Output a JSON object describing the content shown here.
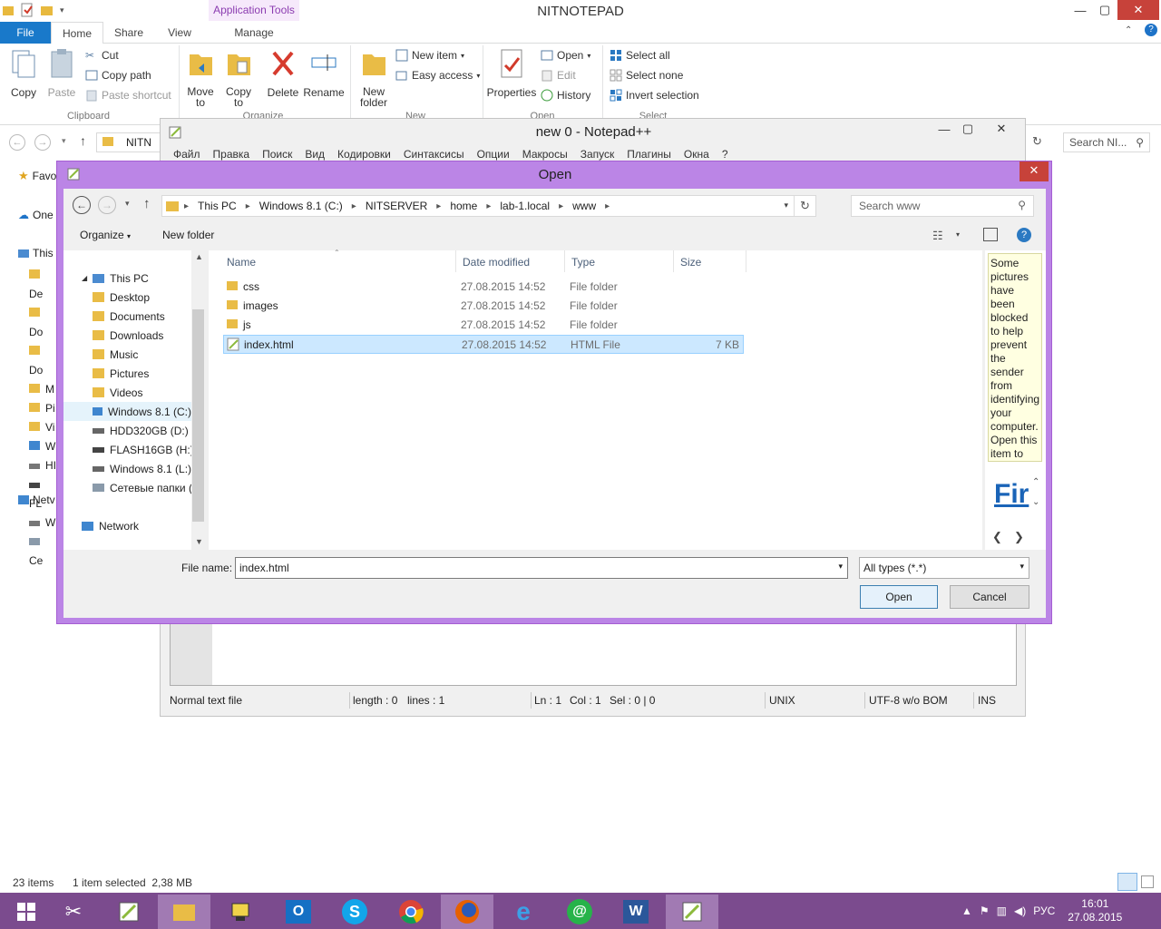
{
  "explorer": {
    "title": "NITNOTEPAD",
    "context_tab": "Application Tools",
    "tabs": [
      "File",
      "Home",
      "Share",
      "View",
      "Manage"
    ],
    "ribbon": {
      "copy": "Copy",
      "paste": "Paste",
      "cut": "Cut",
      "copy_path": "Copy path",
      "paste_shortcut": "Paste shortcut",
      "clipboard": "Clipboard",
      "move_to": "Move to",
      "copy_to": "Copy to",
      "delete": "Delete",
      "rename": "Rename",
      "organize": "Organize",
      "new_folder": "New folder",
      "new_item": "New item",
      "easy_access": "Easy access",
      "new": "New",
      "properties": "Properties",
      "open": "Open",
      "edit": "Edit",
      "history": "History",
      "open_group": "Open",
      "select_all": "Select all",
      "select_none": "Select none",
      "invert_selection": "Invert selection",
      "select": "Select"
    },
    "address_partial": "NITN",
    "search_placeholder": "Search NI...",
    "nav_partial": [
      "Favo",
      "One",
      "This",
      "De",
      "Do",
      "Do",
      "M",
      "Pi",
      "Vi",
      "W",
      "HI",
      "FL",
      "W",
      "Ce",
      "Netv"
    ],
    "status": {
      "items": "23 items",
      "selected": "1 item selected  2,38 MB"
    }
  },
  "notepad": {
    "title": "new  0 - Notepad++",
    "menu": [
      "Файл",
      "Правка",
      "Поиск",
      "Вид",
      "Кодировки",
      "Синтаксисы",
      "Опции",
      "Макросы",
      "Запуск",
      "Плагины",
      "Окна",
      "?"
    ],
    "status": {
      "type": "Normal text file",
      "length": "length : 0",
      "lines": "lines : 1",
      "ln": "Ln : 1",
      "col": "Col : 1",
      "sel": "Sel : 0 | 0",
      "eol": "UNIX",
      "encoding": "UTF-8 w/o BOM",
      "ins": "INS"
    }
  },
  "dialog": {
    "title": "Open",
    "breadcrumb": [
      "This PC",
      "Windows 8.1 (C:)",
      "NITSERVER",
      "home",
      "lab-1.local",
      "www"
    ],
    "search_placeholder": "Search www",
    "organize": "Organize",
    "new_folder": "New folder",
    "tree": [
      "This PC",
      "Desktop",
      "Documents",
      "Downloads",
      "Music",
      "Pictures",
      "Videos",
      "Windows 8.1 (C:)",
      "HDD320GB (D:)",
      "FLASH16GB (H:)",
      "Windows 8.1 (L:)",
      "Сетевые папки (",
      "Network"
    ],
    "columns": [
      "Name",
      "Date modified",
      "Type",
      "Size"
    ],
    "files": [
      {
        "name": "css",
        "date": "27.08.2015 14:52",
        "type": "File folder",
        "size": ""
      },
      {
        "name": "images",
        "date": "27.08.2015 14:52",
        "type": "File folder",
        "size": ""
      },
      {
        "name": "js",
        "date": "27.08.2015 14:52",
        "type": "File folder",
        "size": ""
      },
      {
        "name": "index.html",
        "date": "27.08.2015 14:52",
        "type": "HTML File",
        "size": "7 KB"
      }
    ],
    "preview_message": "Some pictures have been blocked to help prevent the sender from identifying your computer. Open this item to view the",
    "preview_heading": "Fir",
    "file_name_label": "File name:",
    "file_name_value": "index.html",
    "file_type_value": "All types (*.*)",
    "open_button": "Open",
    "cancel_button": "Cancel"
  },
  "taskbar": {
    "tray_lang": "РУС",
    "time": "16:01",
    "date": "27.08.2015"
  }
}
